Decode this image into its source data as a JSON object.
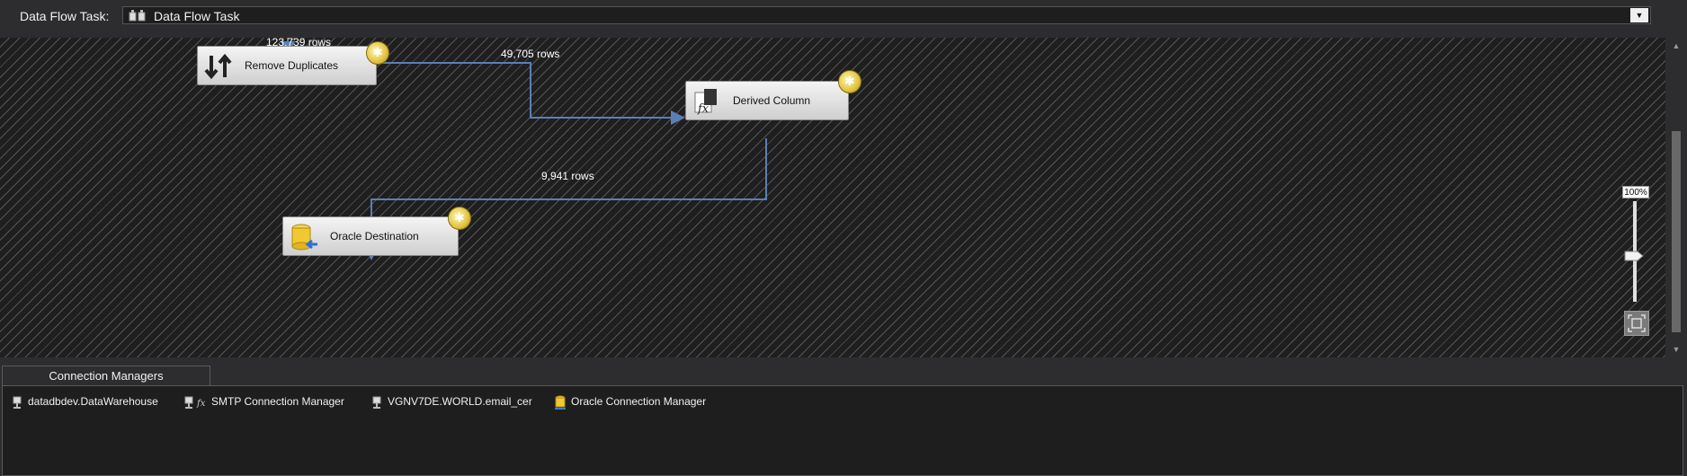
{
  "header": {
    "task_label": "Data Flow Task:",
    "selected_task": "Data Flow Task",
    "dropdown_icon": "chevron-down-icon"
  },
  "canvas": {
    "nodes": [
      {
        "label": "Remove Duplicates",
        "icon": "sort-arrows-icon"
      },
      {
        "label": "Derived Column",
        "icon": "fx-derived-column-icon"
      },
      {
        "label": "Oracle Destination",
        "icon": "database-destination-icon"
      }
    ],
    "row_counts": [
      "123,739 rows",
      "49,705 rows",
      "9,941 rows"
    ],
    "zoom": {
      "label": "100%",
      "level_percent": 100
    }
  },
  "connection_managers": {
    "tab_label": "Connection Managers",
    "items": [
      {
        "label": "datadbdev.DataWarehouse",
        "icon": "db-connection-icon"
      },
      {
        "label": "SMTP Connection Manager",
        "icon": "smtp-fx-connection-icon"
      },
      {
        "label": "VGNV7DE.WORLD.email_cer",
        "icon": "db-connection-icon"
      },
      {
        "label": "Oracle Connection Manager",
        "icon": "oracle-connection-icon"
      }
    ]
  },
  "colors": {
    "flow_arrow": "#5b7fb4",
    "canvas_bg": "#1f1f1f",
    "node_bg": "#e6e6e6",
    "badge": "#e2c340"
  }
}
